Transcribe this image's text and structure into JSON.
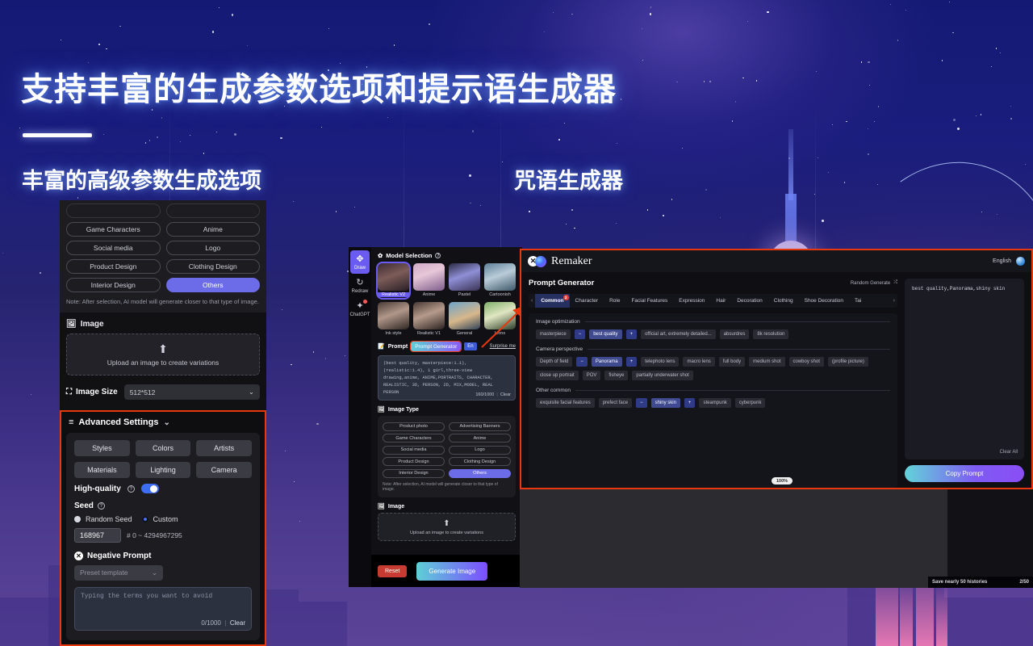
{
  "poster": {
    "heading": "支持丰富的生成参数选项和提示语生成器",
    "sub_left": "丰富的高级参数生成选项",
    "sub_right": "咒语生成器",
    "accent_red": "#e8380d",
    "accent_purple": "#6c6ce8"
  },
  "left_panel": {
    "image_type_chips": [
      [
        "Game Characters",
        "Anime"
      ],
      [
        "Social media",
        "Logo"
      ],
      [
        "Product Design",
        "Clothing Design"
      ],
      [
        "Interior Design",
        "Others"
      ]
    ],
    "selected_chip": "Others",
    "note": "Note: After selection, AI model will generate closer to that type of image.",
    "image_label": "Image",
    "upload_text": "Upload an image to create variations",
    "upload_icon": "upload-icon",
    "image_size_label": "Image Size",
    "image_size_value": "512*512",
    "advanced": {
      "title": "Advanced Settings",
      "chevron": "chevron-down-icon",
      "buttons": [
        "Styles",
        "Colors",
        "Artists",
        "Materials",
        "Lighting",
        "Camera"
      ],
      "high_quality_label": "High-quality",
      "high_quality_on": true,
      "seed_label": "Seed",
      "seed_options": [
        "Random Seed",
        "Custom"
      ],
      "seed_selected": "Custom",
      "seed_value": "168967",
      "seed_hint": "# 0 ~ 4294967295",
      "negative_prompt_label": "Negative Prompt",
      "preset_placeholder": "Preset template",
      "negative_placeholder": "Typing the terms you want to avoid",
      "negative_counter": "0/1000",
      "clear_label": "Clear"
    }
  },
  "mid_panel": {
    "sidebar": [
      {
        "label": "Draw",
        "icon": "draw-icon",
        "active": true,
        "badge": false
      },
      {
        "label": "Redraw",
        "icon": "redraw-icon",
        "active": false,
        "badge": false
      },
      {
        "label": "ChatGPT",
        "icon": "chatgpt-icon",
        "active": false,
        "badge": true
      }
    ],
    "model_selection_title": "Model Selection",
    "models": [
      {
        "name": "Realistic V2",
        "selected": true
      },
      {
        "name": "Anime",
        "selected": false
      },
      {
        "name": "Pastel",
        "selected": false
      },
      {
        "name": "Cartoonish",
        "selected": false
      },
      {
        "name": "Ink style",
        "selected": false
      },
      {
        "name": "Realistic V1",
        "selected": false
      },
      {
        "name": "General",
        "selected": false
      },
      {
        "name": "Icons",
        "selected": false
      }
    ],
    "prompt_label": "Prompt",
    "prompt_generator_button": "Prompt Generator",
    "lang_badge": "En",
    "surprise_me": "Surprise me",
    "prompt_text": "(best quality, masterpiece:1.1), (realistic:1.4), 1 girl,three-view drawing,anime, ANIME,PORTRAITS, CHARACTER, REALISTIC, 3D, PERSON, 2D, MIX,MODEL, REAL PERSON",
    "prompt_counter": "160/1000",
    "prompt_clear": "Clear",
    "image_type_title": "Image Type",
    "image_type_chips": [
      [
        "Product photo",
        "Advertising Banners"
      ],
      [
        "Game Characters",
        "Anime"
      ],
      [
        "Social media",
        "Logo"
      ],
      [
        "Product Design",
        "Clothing Design"
      ],
      [
        "Interior Design",
        "Others"
      ]
    ],
    "image_type_selected": "Others",
    "note": "Note: After selection, AI model will generate closer to that type of image.",
    "image_label": "Image",
    "upload_text": "Upload an image to create variations",
    "reset_button": "Reset",
    "generate_button": "Generate Image"
  },
  "right_panel": {
    "window_title": "Remaker",
    "close_icon": "close-icon",
    "language": "English",
    "globe_icon": "globe-icon",
    "section_title": "Prompt Generator",
    "random_generate": "Random Generate",
    "shuffle_icon": "shuffle-icon",
    "tabs": [
      {
        "label": "Common",
        "active": true,
        "badge": "3"
      },
      {
        "label": "Character",
        "active": false,
        "badge": ""
      },
      {
        "label": "Role",
        "active": false,
        "badge": ""
      },
      {
        "label": "Facial Features",
        "active": false,
        "badge": ""
      },
      {
        "label": "Expression",
        "active": false,
        "badge": ""
      },
      {
        "label": "Hair",
        "active": false,
        "badge": ""
      },
      {
        "label": "Decoration",
        "active": false,
        "badge": ""
      },
      {
        "label": "Clothing",
        "active": false,
        "badge": ""
      },
      {
        "label": "Shoe Decoration",
        "active": false,
        "badge": ""
      },
      {
        "label": "Tai",
        "active": false,
        "badge": ""
      }
    ],
    "groups": [
      {
        "title": "Image optimization",
        "tags": [
          {
            "label": "masterpiece",
            "state": "off"
          },
          {
            "label": "−",
            "state": "minus"
          },
          {
            "label": "best quality",
            "state": "on"
          },
          {
            "label": "+",
            "state": "plus"
          },
          {
            "label": "official art, extremely detailed...",
            "state": "off"
          },
          {
            "label": "absurdres",
            "state": "off"
          },
          {
            "label": "8k resolution",
            "state": "off"
          }
        ]
      },
      {
        "title": "Camera perspective",
        "tags": [
          {
            "label": "Depth of field",
            "state": "off"
          },
          {
            "label": "−",
            "state": "minus"
          },
          {
            "label": "Panorama",
            "state": "on"
          },
          {
            "label": "+",
            "state": "plus"
          },
          {
            "label": "telephoto lens",
            "state": "off"
          },
          {
            "label": "macro lens",
            "state": "off"
          },
          {
            "label": "full body",
            "state": "off"
          },
          {
            "label": "medium shot",
            "state": "off"
          },
          {
            "label": "cowboy shot",
            "state": "off"
          },
          {
            "label": "(profile picture)",
            "state": "off"
          },
          {
            "label": "close up portrait",
            "state": "off"
          },
          {
            "label": "POV",
            "state": "off"
          },
          {
            "label": "fisheye",
            "state": "off"
          },
          {
            "label": "partially underwater shot",
            "state": "off"
          }
        ]
      },
      {
        "title": "Other common",
        "tags": [
          {
            "label": "exquisite facial features",
            "state": "off"
          },
          {
            "label": "prefect face",
            "state": "off"
          },
          {
            "label": "−",
            "state": "minus"
          },
          {
            "label": "shiny skin",
            "state": "on"
          },
          {
            "label": "+",
            "state": "plus"
          },
          {
            "label": "steampunk",
            "state": "off"
          },
          {
            "label": "cyberpunk",
            "state": "off"
          }
        ]
      }
    ],
    "output_text": "best quality,Panorama,shiny skin",
    "clear_all": "Clear All",
    "copy_prompt": "Copy Prompt",
    "zoom_level": "100%"
  },
  "status_bar": {
    "history_text": "Save nearly 50 histories",
    "history_count": "2/50"
  }
}
